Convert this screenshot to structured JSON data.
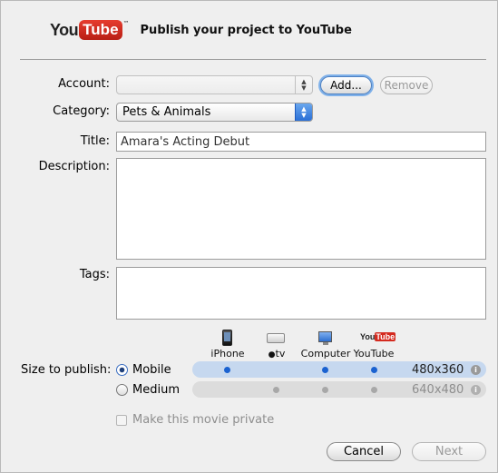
{
  "header": {
    "logo_you": "You",
    "logo_tube": "Tube",
    "logo_tm": "™",
    "title": "Publish your project to YouTube"
  },
  "form": {
    "account_label": "Account:",
    "account_value": "",
    "add_button": "Add...",
    "remove_button": "Remove",
    "category_label": "Category:",
    "category_value": "Pets & Animals",
    "title_label": "Title:",
    "title_value": "Amara's Acting Debut",
    "description_label": "Description:",
    "description_value": "",
    "tags_label": "Tags:",
    "tags_value": ""
  },
  "size": {
    "label": "Size to publish:",
    "columns": [
      "iPhone",
      "tv",
      "Computer",
      "YouTube"
    ],
    "options": [
      {
        "label": "Mobile",
        "resolution": "480x360",
        "selected": true,
        "dots": [
          true,
          false,
          true,
          true
        ]
      },
      {
        "label": "Medium",
        "resolution": "640x480",
        "selected": false,
        "dots": [
          false,
          true,
          true,
          true
        ]
      }
    ]
  },
  "private_label": "Make this movie private",
  "footer": {
    "cancel": "Cancel",
    "next": "Next"
  }
}
